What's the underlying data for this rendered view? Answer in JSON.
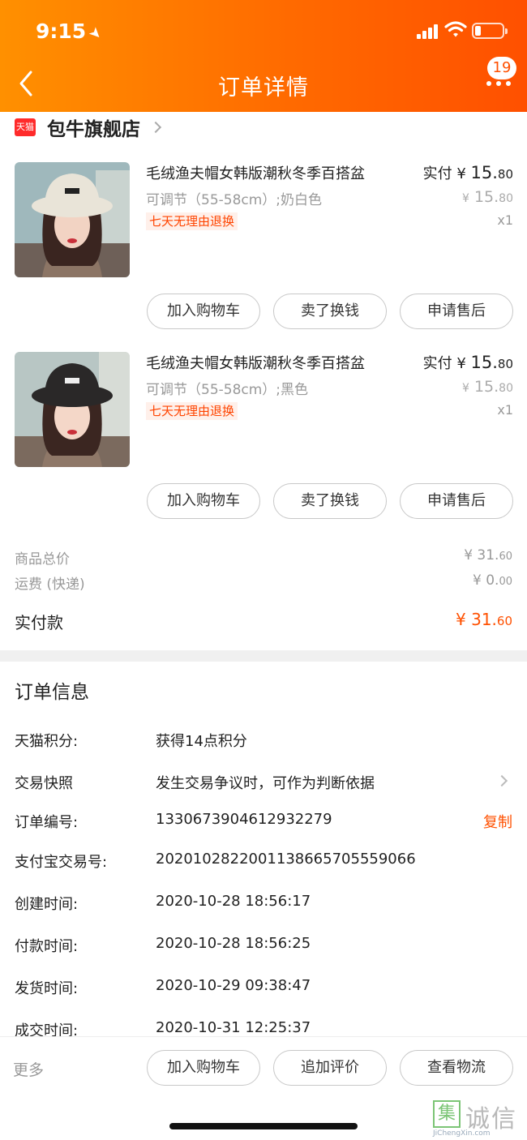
{
  "status_bar": {
    "time": "9:15"
  },
  "nav": {
    "title": "订单详情",
    "badge_count": "19",
    "icons": [
      "back-icon",
      "more-dots-icon"
    ]
  },
  "store": {
    "logo_text": "天猫",
    "name": "包牛旗舰店"
  },
  "products": [
    {
      "title": "毛绒渔夫帽女韩版潮秋冬季百搭盆",
      "sku": "可调节（55-58cm）;奶白色",
      "tag": "七天无理由退换",
      "paid_label": "实付",
      "currency": "¥",
      "paid_int": "15.",
      "paid_dec": "80",
      "orig_int": "15.",
      "orig_dec": "80",
      "qty": "x1",
      "hat_color": "#e9e4d8",
      "buttons": [
        "加入购物车",
        "卖了换钱",
        "申请售后"
      ]
    },
    {
      "title": "毛绒渔夫帽女韩版潮秋冬季百搭盆",
      "sku": "可调节（55-58cm）;黑色",
      "tag": "七天无理由退换",
      "paid_label": "实付",
      "currency": "¥",
      "paid_int": "15.",
      "paid_dec": "80",
      "orig_int": "15.",
      "orig_dec": "80",
      "qty": "x1",
      "hat_color": "#2a2828",
      "buttons": [
        "加入购物车",
        "卖了换钱",
        "申请售后"
      ]
    }
  ],
  "summary": {
    "goods_total_label": "商品总价",
    "goods_total_int": "¥ 31.",
    "goods_total_dec": "60",
    "shipping_label": "运费 (快递)",
    "shipping_int": "¥ 0.",
    "shipping_dec": "00",
    "paid_label": "实付款",
    "paid_int": "¥ 31.",
    "paid_dec": "60"
  },
  "order_info": {
    "title": "订单信息",
    "rows": [
      {
        "label": "天猫积分:",
        "value": "获得14点积分"
      },
      {
        "label": "交易快照",
        "value": "发生交易争议时，可作为判断依据"
      },
      {
        "label": "订单编号:",
        "value": "1330673904612932279",
        "action": "复制"
      },
      {
        "label": "支付宝交易号:",
        "value": "2020102822001138665705559066"
      },
      {
        "label": "创建时间:",
        "value": "2020-10-28 18:56:17"
      },
      {
        "label": "付款时间:",
        "value": "2020-10-28 18:56:25"
      },
      {
        "label": "发货时间:",
        "value": "2020-10-29 09:38:47"
      },
      {
        "label": "成交时间:",
        "value": "2020-10-31 12:25:37"
      }
    ]
  },
  "bottom_bar": {
    "more": "更多",
    "buttons": [
      "加入购物车",
      "追加评价",
      "查看物流"
    ]
  },
  "watermark": {
    "mark": "集",
    "text": "诚信",
    "url": "JiChengXin.com"
  },
  "colors": {
    "accent": "#ff5000",
    "header_start": "#ff9000",
    "header_end": "#ff5000"
  }
}
